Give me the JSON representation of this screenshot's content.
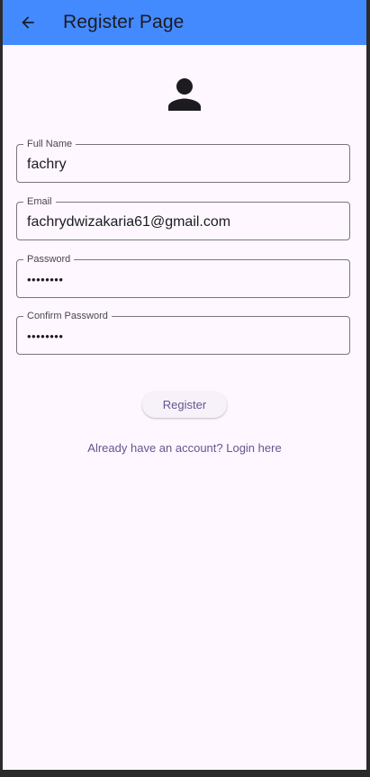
{
  "appbar": {
    "title": "Register Page",
    "back_icon": "arrow-back-icon",
    "color": "#448aff"
  },
  "avatar_icon": "person-icon",
  "form": {
    "full_name": {
      "label": "Full Name",
      "value": "fachry"
    },
    "email": {
      "label": "Email",
      "value": "fachrydwizakaria61@gmail.com"
    },
    "password": {
      "label": "Password",
      "value": "••••••••"
    },
    "confirm_password": {
      "label": "Confirm Password",
      "value": "••••••••"
    }
  },
  "register_label": "Register",
  "login_link": "Already have an account? Login here",
  "accent_color": "#65558f"
}
